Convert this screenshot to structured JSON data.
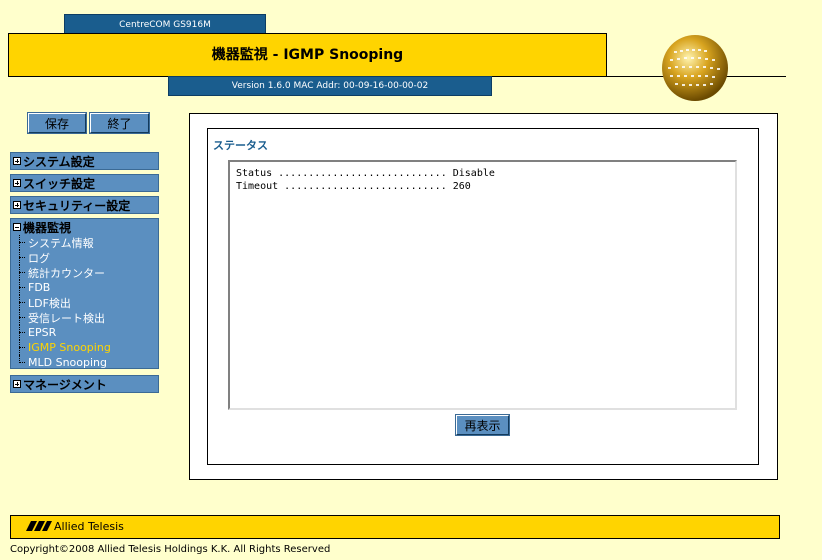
{
  "header": {
    "model": "CentreCOM GS916M",
    "title": "機器監視 - IGMP Snooping",
    "version": "Version 1.6.0 MAC Addr: 00-09-16-00-00-02"
  },
  "buttons": {
    "save": "保存",
    "exit": "終了",
    "refresh": "再表示"
  },
  "sidebar": {
    "system_settings": "システム設定",
    "switch_settings": "スイッチ設定",
    "security_settings": "セキュリティー設定",
    "monitoring": {
      "label": "機器監視",
      "items": [
        "システム情報",
        "ログ",
        "統計カウンター",
        "FDB",
        "LDF検出",
        "受信レート検出",
        "EPSR",
        "IGMP Snooping",
        "MLD Snooping"
      ],
      "active_item": "IGMP Snooping"
    },
    "management": "マネージメント"
  },
  "status": {
    "heading": "ステータス",
    "lines": [
      "Status ............................ Disable",
      "Timeout ........................... 260"
    ]
  },
  "footer": {
    "logo_text": "Allied Telesis",
    "copyright": "Copyright©2008 Allied Telesis Holdings K.K. All Rights Reserved"
  },
  "colors": {
    "background": "#ffffcc",
    "accent_yellow": "#ffd400",
    "header_blue": "#1a5d8e",
    "sidebar_blue": "#5b8fc0",
    "active_item": "#ffd400"
  }
}
